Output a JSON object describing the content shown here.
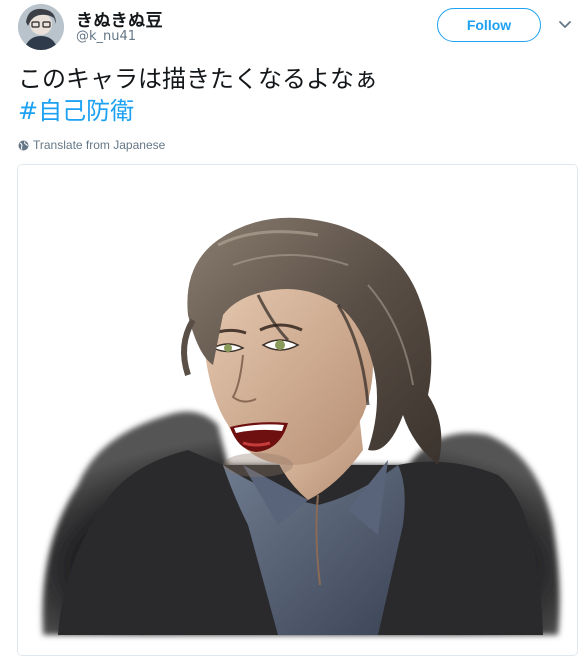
{
  "tweet": {
    "display_name": "きぬきぬ豆",
    "handle": "@k_nu41",
    "follow_label": "Follow",
    "text": "このキャラは描きたくなるよなぁ",
    "hashtag": "#自己防衛",
    "translate_label": "Translate from Japanese"
  },
  "icons": {
    "more": "chevron-down-icon",
    "translate": "globe-icon"
  },
  "colors": {
    "accent": "#1da1f2",
    "text": "#14171a",
    "secondary": "#657786",
    "border": "#e1e8ed"
  }
}
